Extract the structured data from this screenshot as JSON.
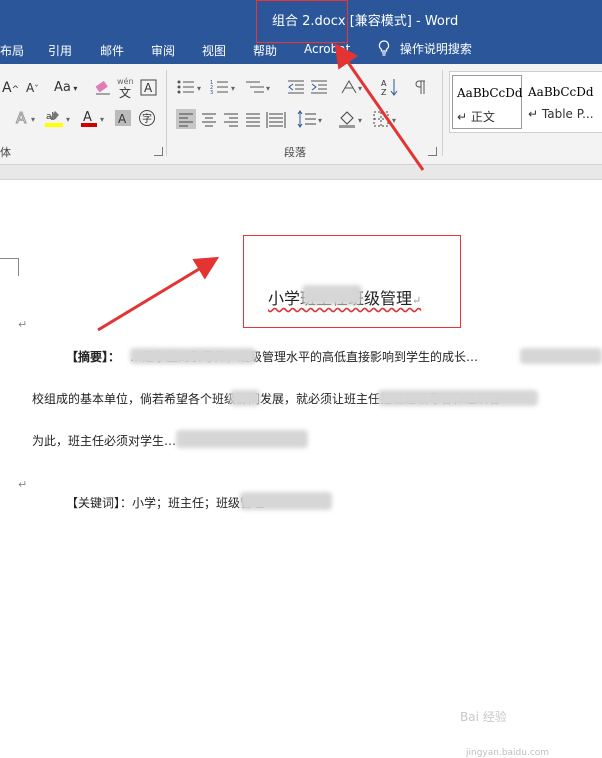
{
  "titlebar": {
    "text": "组合 2.docx [兼容模式] - Word"
  },
  "tabs": [
    "布局",
    "引用",
    "邮件",
    "审阅",
    "视图",
    "帮助",
    "Acrobat"
  ],
  "tell_me": "操作说明搜索",
  "ribbon": {
    "font_size_label": "Aa",
    "wen_label": "wén",
    "wen_char": "文",
    "font_group_label": "体",
    "paragraph_group_label": "段落"
  },
  "styles": [
    {
      "preview": "AaBbCcDd",
      "name": "正文"
    },
    {
      "preview": "AaBbCcDd",
      "name": "Table P..."
    }
  ],
  "document": {
    "title_visible": "小学班主任班级管理",
    "abstract_label": "【摘要】：",
    "line1": "…是学生的引导师，班级管理水平的高低直接影响到学生的成长…",
    "line2": "校组成的基本单位，倘若希望各个班级协同发展，就必须让班主任担当起领导者和组织者",
    "line3": "为此，班主任必须对学生…",
    "keywords_label": "【关键词】：小学；班主任；班级管理",
    "paragraph_mark": "↵"
  },
  "watermark": {
    "brand": "Bai 经验",
    "site": "jingyan.baidu.com"
  },
  "colors": {
    "titlebar": "#2b579a",
    "annotation": "#e33333"
  }
}
